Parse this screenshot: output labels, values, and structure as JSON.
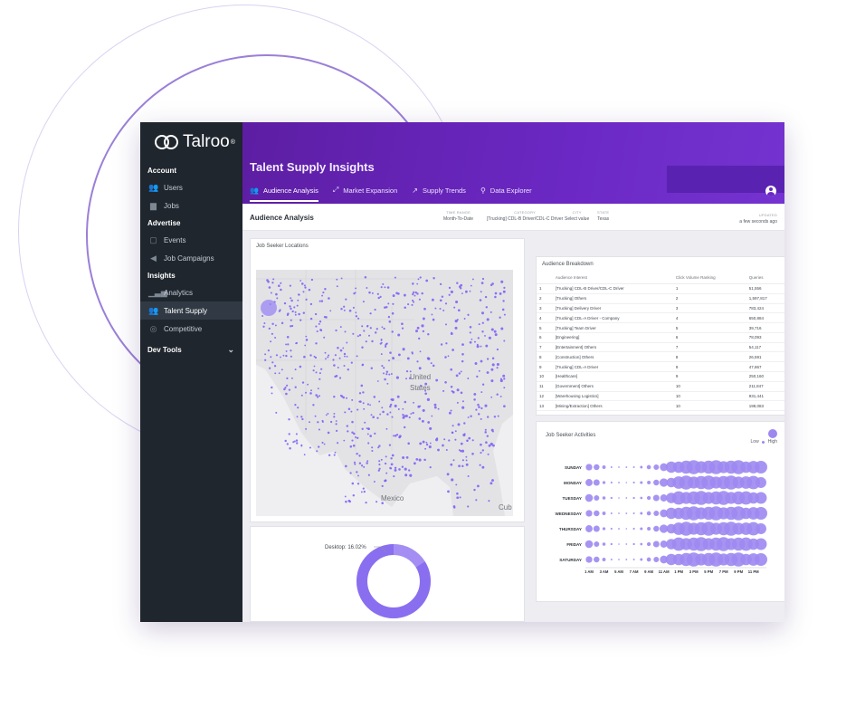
{
  "brand": {
    "name": "Talroo",
    "tm": "®"
  },
  "sidebar": {
    "sections": [
      {
        "label": "Account",
        "items": [
          {
            "label": "Users",
            "icon": "users-icon"
          },
          {
            "label": "Jobs",
            "icon": "briefcase-icon"
          }
        ]
      },
      {
        "label": "Advertise",
        "items": [
          {
            "label": "Events",
            "icon": "calendar-icon"
          },
          {
            "label": "Job Campaigns",
            "icon": "megaphone-icon"
          }
        ]
      },
      {
        "label": "Insights",
        "items": [
          {
            "label": "Analytics",
            "icon": "bar-chart-icon"
          },
          {
            "label": "Talent Supply",
            "icon": "people-icon",
            "active": true
          },
          {
            "label": "Competitive",
            "icon": "target-icon"
          }
        ]
      }
    ],
    "dev_tools": "Dev Tools"
  },
  "header": {
    "title": "Talent Supply Insights",
    "tabs": [
      {
        "label": "Audience Analysis",
        "icon": "people-icon",
        "active": true
      },
      {
        "label": "Market Expansion",
        "icon": "expand-icon"
      },
      {
        "label": "Supply Trends",
        "icon": "trend-icon"
      },
      {
        "label": "Data Explorer",
        "icon": "search-icon"
      }
    ]
  },
  "filters": {
    "title": "Audience Analysis",
    "time_range": {
      "label": "TIME RANGE",
      "value": "Month-To-Date"
    },
    "category": {
      "label": "CATEGORY",
      "value": "[Trucking] CDL-B Driver/CDL-C Driver"
    },
    "city": {
      "label": "CITY",
      "value": "Select value"
    },
    "state": {
      "label": "STATE",
      "value": "Texas"
    },
    "updated": {
      "label": "UPDATED",
      "value": "a few seconds ago"
    }
  },
  "locations": {
    "title": "Job Seeker Locations",
    "country_label_1": "United",
    "country_label_2": "States",
    "mexico_label": "Mexico",
    "cuba_label": "Cub"
  },
  "breakdown": {
    "title": "Audience Breakdown",
    "columns": [
      "",
      "Audience Interest",
      "Click Volume Ranking",
      "Queries"
    ],
    "rows": [
      [
        "1",
        "[Trucking] CDL-B Driver/CDL-C Driver",
        "1",
        "51,556"
      ],
      [
        "2",
        "[Trucking] Others",
        "2",
        "1,597,817"
      ],
      [
        "3",
        "[Trucking] Delivery Driver",
        "3",
        "783,424"
      ],
      [
        "4",
        "[Trucking] CDL-A Driver - Company",
        "4",
        "650,884"
      ],
      [
        "5",
        "[Trucking] Team Driver",
        "5",
        "39,716"
      ],
      [
        "6",
        "[Engineering]",
        "6",
        "78,093"
      ],
      [
        "7",
        "[Entertainment] Others",
        "7",
        "54,117"
      ],
      [
        "8",
        "[Construction] Others",
        "8",
        "26,591"
      ],
      [
        "9",
        "[Trucking] CDL-A Driver",
        "9",
        "47,867"
      ],
      [
        "10",
        "[Healthcare]",
        "9",
        "250,160"
      ],
      [
        "11",
        "[Government] Others",
        "10",
        "211,847"
      ],
      [
        "12",
        "[Warehousing Logistics]",
        "10",
        "931,441"
      ],
      [
        "13",
        "[Mining/Extraction] Others",
        "10",
        "198,083"
      ]
    ]
  },
  "activities": {
    "title": "Job Seeker Activities",
    "legend_low": "Low",
    "legend_high": "High",
    "days": [
      "SUNDAY",
      "MONDAY",
      "TUESDAY",
      "WEDNESDAY",
      "THURSDAY",
      "FRIDAY",
      "SATURDAY"
    ],
    "hour_labels": [
      "1 AM",
      "3 AM",
      "5 AM",
      "7 AM",
      "9 AM",
      "11 AM",
      "1 PM",
      "3 PM",
      "5 PM",
      "7 PM",
      "9 PM",
      "11 PM"
    ],
    "intensity": [
      0.55,
      0.45,
      0.25,
      0.15,
      0.12,
      0.12,
      0.15,
      0.2,
      0.3,
      0.45,
      0.6,
      0.8,
      0.95,
      1,
      1,
      1,
      1,
      1,
      1,
      1,
      1,
      0.95,
      0.95,
      0.9
    ]
  },
  "device": {
    "label": "Desktop: 16.02%",
    "desktop_share": 16.02
  },
  "colors": {
    "accent": "#6b28c4",
    "sidebar": "#1f262e",
    "dot": "#7c5cf2"
  }
}
